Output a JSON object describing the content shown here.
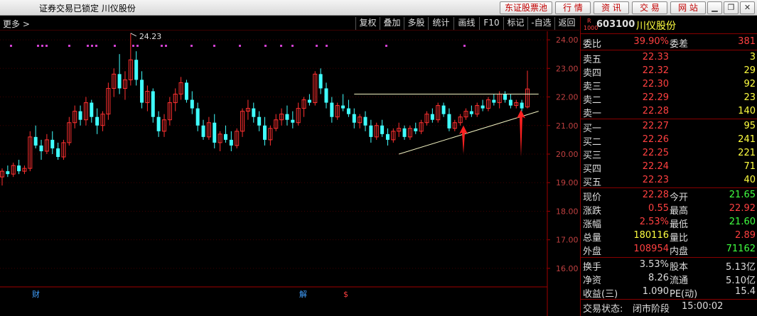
{
  "window": {
    "title": "证券交易已锁定  川仪股份",
    "buttons": [
      "东证股票池",
      "行 情",
      "资 讯",
      "交 易",
      "网 站"
    ]
  },
  "toolbar": {
    "more": "更多 >",
    "items": [
      "复权",
      "叠加",
      "多股",
      "统计",
      "画线",
      "F10",
      "标记",
      "-自选",
      "返回"
    ]
  },
  "stock": {
    "badge_r": "R",
    "badge_num": "1000",
    "code": "603100",
    "name": "川仪股份"
  },
  "ratio": {
    "label": "委比",
    "value": "39.90%",
    "label2": "委差",
    "value2": "381"
  },
  "asks": [
    {
      "label": "卖五",
      "price": "22.33",
      "vol": "3"
    },
    {
      "label": "卖四",
      "price": "22.32",
      "vol": "29"
    },
    {
      "label": "卖三",
      "price": "22.30",
      "vol": "92"
    },
    {
      "label": "卖二",
      "price": "22.29",
      "vol": "23"
    },
    {
      "label": "卖一",
      "price": "22.28",
      "vol": "140"
    }
  ],
  "bids": [
    {
      "label": "买一",
      "price": "22.27",
      "vol": "95"
    },
    {
      "label": "买二",
      "price": "22.26",
      "vol": "241"
    },
    {
      "label": "买三",
      "price": "22.25",
      "vol": "221"
    },
    {
      "label": "买四",
      "price": "22.24",
      "vol": "71"
    },
    {
      "label": "买五",
      "price": "22.23",
      "vol": "40"
    }
  ],
  "quote": [
    {
      "l1": "现价",
      "v1": "22.28",
      "c1": "red",
      "l2": "今开",
      "v2": "21.65",
      "c2": "green"
    },
    {
      "l1": "涨跌",
      "v1": "0.55",
      "c1": "red",
      "l2": "最高",
      "v2": "22.92",
      "c2": "red"
    },
    {
      "l1": "涨幅",
      "v1": "2.53%",
      "c1": "red",
      "l2": "最低",
      "v2": "21.60",
      "c2": "green"
    },
    {
      "l1": "总量",
      "v1": "180116",
      "c1": "yellow",
      "l2": "量比",
      "v2": "2.89",
      "c2": "red"
    },
    {
      "l1": "外盘",
      "v1": "108954",
      "c1": "red",
      "l2": "内盘",
      "v2": "71162",
      "c2": "green"
    }
  ],
  "fund": [
    {
      "l1": "换手",
      "v1": "3.53%",
      "l2": "股本",
      "v2": "5.13亿"
    },
    {
      "l1": "净资",
      "v1": "8.26",
      "l2": "流通",
      "v2": "5.10亿"
    },
    {
      "l1": "收益(三)",
      "v1": "1.090",
      "l2": "PE(动)",
      "v2": "15.4"
    }
  ],
  "status": {
    "label": "交易状态:",
    "phase": "闭市阶段",
    "time": "15:00:02"
  },
  "chart_data": {
    "type": "candlestick",
    "y_ticks": [
      "24.00",
      "23.00",
      "22.00",
      "21.00",
      "20.00",
      "19.00",
      "18.00",
      "17.00",
      "16.00"
    ],
    "ylim": [
      15.6,
      24.3
    ],
    "peak_label": "24.23",
    "bottom_markers": [
      "财",
      "解",
      "$"
    ],
    "candles": [
      [
        19.2,
        19.5,
        18.9,
        19.4
      ],
      [
        19.4,
        19.6,
        19.2,
        19.3
      ],
      [
        19.3,
        19.7,
        19.2,
        19.6
      ],
      [
        19.6,
        19.8,
        19.3,
        19.4
      ],
      [
        19.4,
        19.6,
        19.3,
        19.5
      ],
      [
        19.5,
        20.8,
        19.4,
        20.6
      ],
      [
        20.6,
        21.0,
        20.2,
        20.3
      ],
      [
        20.3,
        20.5,
        19.8,
        20.1
      ],
      [
        20.1,
        20.7,
        20.0,
        20.5
      ],
      [
        20.5,
        20.8,
        20.0,
        20.2
      ],
      [
        20.2,
        20.4,
        19.8,
        19.9
      ],
      [
        19.9,
        20.5,
        19.8,
        20.4
      ],
      [
        20.4,
        21.3,
        20.3,
        21.1
      ],
      [
        21.1,
        21.7,
        20.9,
        21.5
      ],
      [
        21.5,
        21.7,
        21.0,
        21.2
      ],
      [
        21.2,
        22.0,
        21.0,
        21.8
      ],
      [
        21.8,
        21.9,
        21.1,
        21.3
      ],
      [
        21.3,
        21.6,
        20.7,
        21.0
      ],
      [
        21.0,
        21.5,
        20.8,
        21.4
      ],
      [
        21.4,
        22.5,
        21.2,
        22.3
      ],
      [
        22.3,
        23.0,
        22.0,
        22.8
      ],
      [
        22.8,
        23.5,
        22.1,
        22.3
      ],
      [
        22.3,
        22.9,
        21.9,
        22.6
      ],
      [
        22.6,
        24.23,
        22.4,
        23.3
      ],
      [
        23.3,
        23.6,
        22.4,
        22.6
      ],
      [
        22.6,
        22.9,
        21.6,
        21.8
      ],
      [
        21.8,
        22.4,
        21.5,
        22.2
      ],
      [
        22.2,
        22.3,
        21.1,
        21.3
      ],
      [
        21.3,
        21.5,
        20.6,
        20.8
      ],
      [
        20.8,
        21.4,
        20.6,
        21.2
      ],
      [
        21.2,
        22.0,
        21.0,
        21.8
      ],
      [
        21.8,
        22.3,
        21.5,
        22.1
      ],
      [
        22.1,
        22.7,
        21.9,
        22.5
      ],
      [
        22.5,
        22.6,
        21.8,
        21.9
      ],
      [
        21.9,
        22.2,
        21.4,
        21.6
      ],
      [
        21.6,
        21.8,
        20.8,
        21.0
      ],
      [
        21.0,
        21.2,
        20.5,
        20.6
      ],
      [
        20.6,
        21.3,
        20.5,
        21.1
      ],
      [
        21.1,
        21.4,
        20.2,
        20.4
      ],
      [
        20.4,
        20.8,
        20.1,
        20.7
      ],
      [
        20.7,
        21.0,
        20.4,
        20.5
      ],
      [
        20.5,
        20.8,
        20.1,
        20.3
      ],
      [
        20.3,
        20.9,
        20.2,
        20.8
      ],
      [
        20.8,
        21.6,
        20.6,
        21.5
      ],
      [
        21.5,
        21.9,
        21.2,
        21.6
      ],
      [
        21.6,
        21.8,
        21.1,
        21.3
      ],
      [
        21.3,
        21.5,
        20.8,
        21.0
      ],
      [
        21.0,
        21.3,
        20.3,
        20.5
      ],
      [
        20.5,
        21.0,
        20.3,
        20.9
      ],
      [
        20.9,
        21.4,
        20.8,
        21.2
      ],
      [
        21.2,
        21.6,
        21.0,
        21.4
      ],
      [
        21.4,
        21.7,
        21.0,
        21.2
      ],
      [
        21.2,
        21.5,
        20.9,
        21.1
      ],
      [
        21.1,
        21.8,
        21.0,
        21.6
      ],
      [
        21.6,
        22.0,
        21.3,
        21.9
      ],
      [
        21.9,
        22.1,
        21.7,
        21.8
      ],
      [
        21.8,
        22.9,
        21.7,
        22.8
      ],
      [
        22.8,
        23.0,
        22.1,
        22.3
      ],
      [
        22.3,
        22.5,
        21.6,
        21.8
      ],
      [
        21.8,
        22.0,
        21.1,
        21.3
      ],
      [
        21.3,
        21.8,
        21.2,
        21.7
      ],
      [
        21.7,
        22.1,
        21.5,
        21.6
      ],
      [
        21.6,
        21.9,
        21.3,
        21.4
      ],
      [
        21.4,
        21.6,
        20.9,
        21.1
      ],
      [
        21.1,
        21.4,
        20.9,
        21.3
      ],
      [
        21.3,
        21.5,
        20.8,
        21.0
      ],
      [
        21.0,
        21.2,
        20.4,
        20.6
      ],
      [
        20.6,
        21.1,
        20.5,
        21.0
      ],
      [
        21.0,
        21.2,
        20.6,
        20.7
      ],
      [
        20.7,
        20.9,
        20.3,
        20.5
      ],
      [
        20.5,
        20.9,
        20.4,
        20.8
      ],
      [
        20.8,
        21.1,
        20.6,
        20.9
      ],
      [
        20.9,
        21.0,
        20.5,
        20.6
      ],
      [
        20.6,
        21.0,
        20.5,
        20.9
      ],
      [
        20.9,
        21.1,
        20.7,
        20.8
      ],
      [
        20.8,
        21.2,
        20.7,
        21.1
      ],
      [
        21.1,
        21.5,
        21.0,
        21.4
      ],
      [
        21.4,
        21.6,
        21.1,
        21.2
      ],
      [
        21.2,
        21.8,
        21.1,
        21.7
      ],
      [
        21.7,
        21.8,
        21.3,
        21.4
      ],
      [
        21.4,
        21.6,
        20.8,
        20.9
      ],
      [
        20.9,
        21.2,
        20.8,
        21.1
      ],
      [
        21.1,
        21.4,
        21.0,
        21.3
      ],
      [
        21.3,
        21.6,
        21.2,
        21.5
      ],
      [
        21.5,
        21.7,
        21.3,
        21.4
      ],
      [
        21.4,
        21.8,
        21.3,
        21.7
      ],
      [
        21.7,
        21.9,
        21.5,
        21.6
      ],
      [
        21.6,
        22.0,
        21.5,
        21.9
      ],
      [
        21.9,
        22.1,
        21.7,
        21.8
      ],
      [
        21.8,
        22.2,
        21.6,
        22.1
      ],
      [
        22.1,
        22.2,
        21.8,
        21.9
      ],
      [
        21.9,
        22.1,
        21.6,
        21.7
      ],
      [
        21.7,
        21.9,
        21.6,
        21.8
      ],
      [
        21.8,
        21.9,
        21.5,
        21.6
      ],
      [
        21.65,
        22.92,
        21.6,
        22.28
      ]
    ]
  }
}
